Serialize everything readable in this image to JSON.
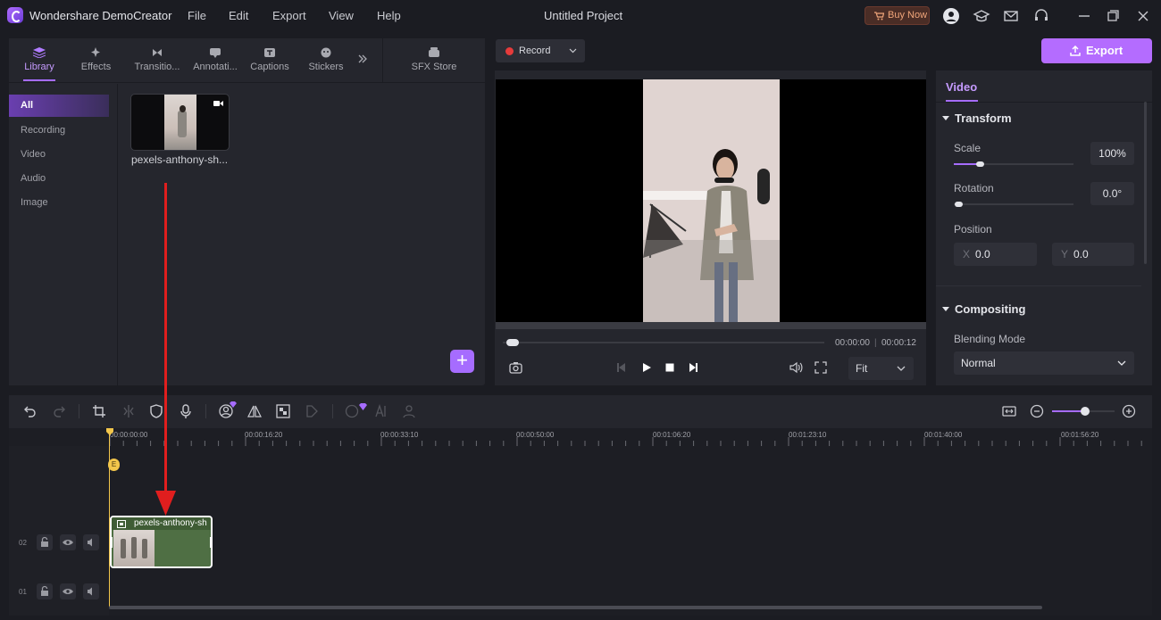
{
  "app": {
    "name": "Wondershare DemoCreator",
    "project_title": "Untitled Project",
    "menu": [
      "File",
      "Edit",
      "Export",
      "View",
      "Help"
    ],
    "buy_now": "Buy Now"
  },
  "library": {
    "tabs": [
      "Library",
      "Effects",
      "Transitio...",
      "Annotati...",
      "Captions",
      "Stickers"
    ],
    "sfx_store": "SFX Store",
    "categories": [
      "All",
      "Recording",
      "Video",
      "Audio",
      "Image"
    ],
    "media_item": "pexels-anthony-sh..."
  },
  "preview": {
    "record_label": "Record",
    "current_time": "00:00:00",
    "total_time": "00:00:12",
    "fit_label": "Fit",
    "progress": 0
  },
  "export_label": "Export",
  "properties": {
    "tab": "Video",
    "transform_label": "Transform",
    "scale_label": "Scale",
    "scale_value": "100%",
    "rotation_label": "Rotation",
    "rotation_value": "0.0°",
    "position_label": "Position",
    "x_label": "X",
    "x_value": "0.0",
    "y_label": "Y",
    "y_value": "0.0",
    "compositing_label": "Compositing",
    "blending_label": "Blending Mode",
    "blending_value": "Normal"
  },
  "timeline": {
    "ruler": [
      "00:00:00:00",
      "00:00:16:20",
      "00:00:33:10",
      "00:00:50:00",
      "00:01:06:20",
      "00:01:23:10",
      "00:01:40:00",
      "00:01:56:20"
    ],
    "tracks": [
      "02",
      "01"
    ],
    "clip_name": "pexels-anthony-sh",
    "playhead_marker": "E"
  },
  "colors": {
    "accent": "#a66cff",
    "export": "#b46cff",
    "playhead": "#f3c64b",
    "clip": "#4f6f44",
    "annotation_arrow": "#e01e1e"
  }
}
